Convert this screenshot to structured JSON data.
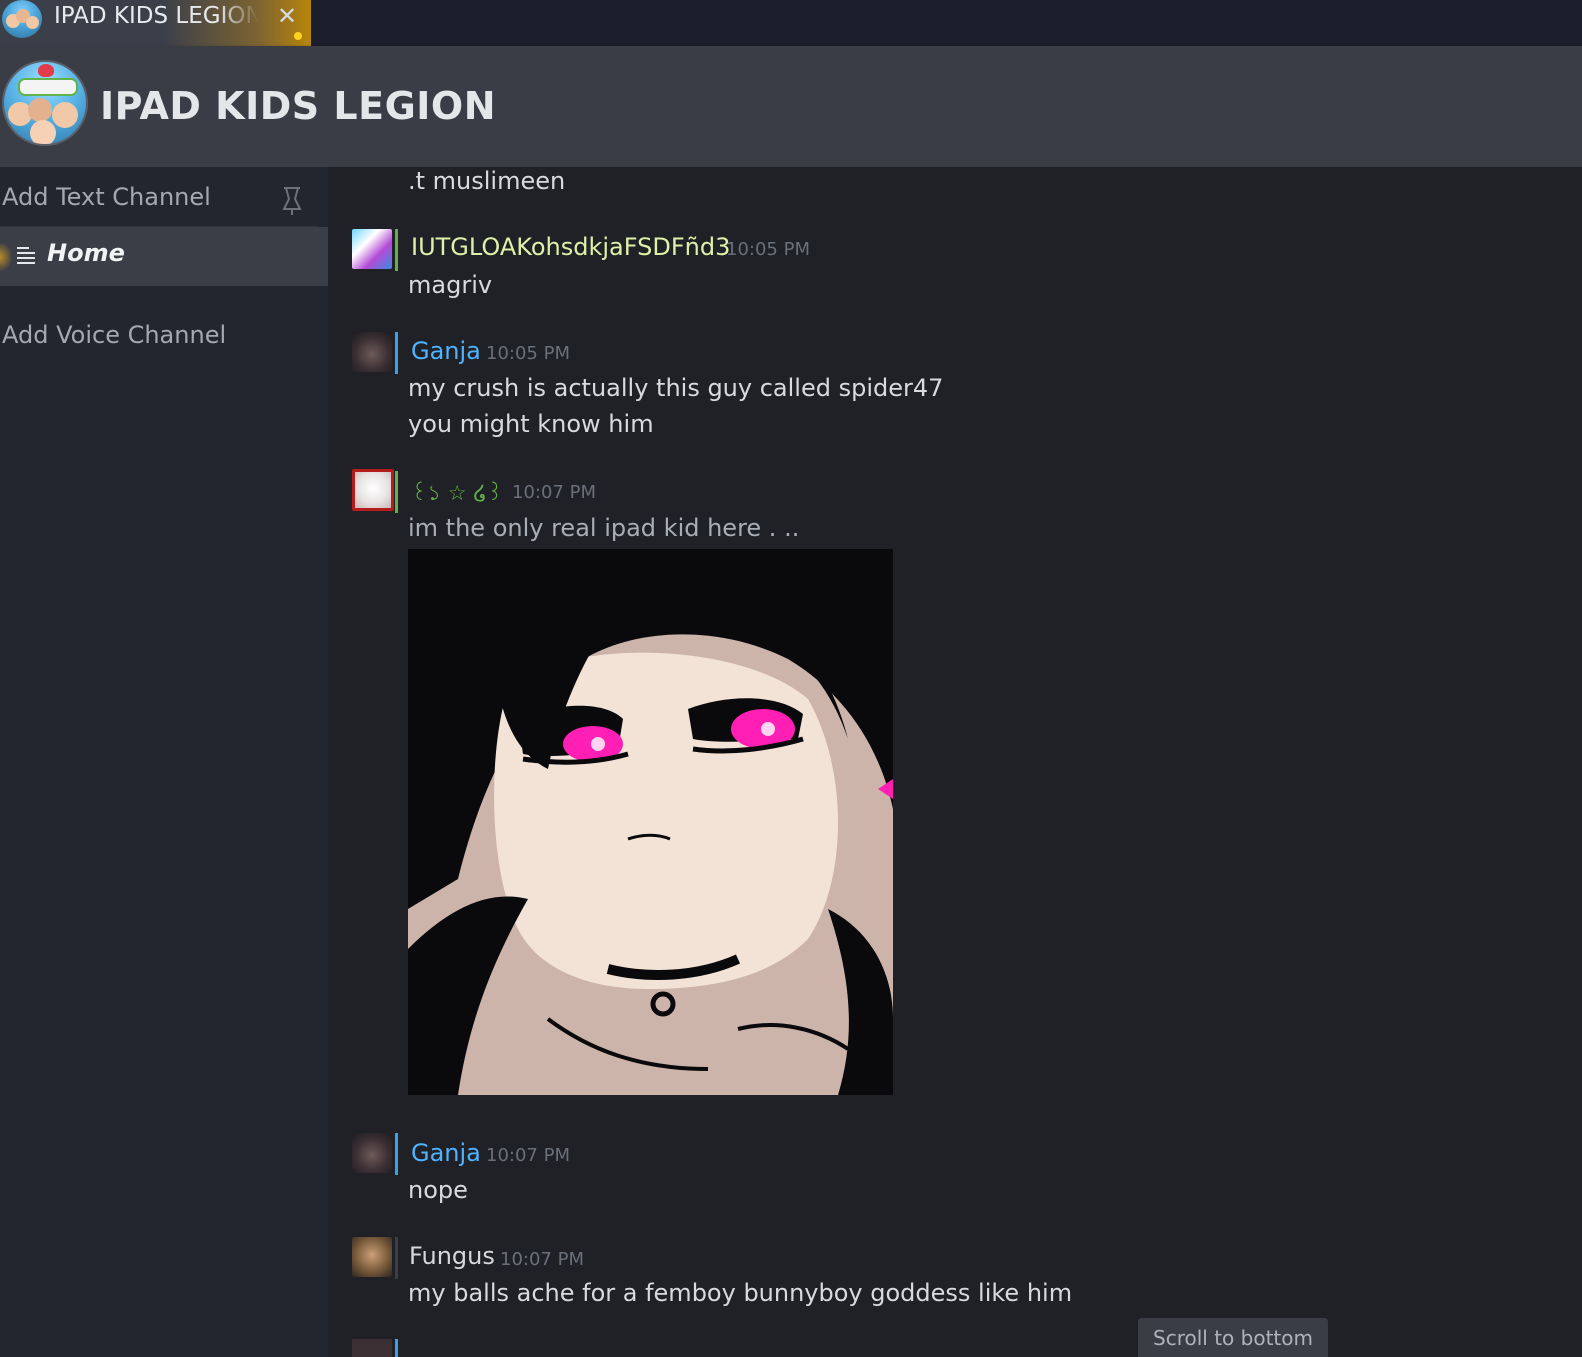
{
  "tab": {
    "title": "IPAD KIDS LEGION",
    "close_glyph": "✕",
    "unread_dot_color": "#ffd21f"
  },
  "server": {
    "name": "IPAD KIDS LEGION",
    "icon": "cocomelon-server-icon"
  },
  "sidebar": {
    "add_text_channel": "Add Text Channel",
    "pin_icon": "pin-icon",
    "home_label": "Home",
    "home_icon": "hamburger-icon",
    "add_voice_channel": "Add Voice Channel"
  },
  "messages": [
    {
      "author": "",
      "time": "",
      "lines": [
        ".t muslimeen"
      ]
    },
    {
      "author": "IUTGLOAKohsdkjaFSDFñd3",
      "author_color": "#dff0a8",
      "time": "10:05 PM",
      "lines": [
        "magriv"
      ]
    },
    {
      "author": "Ganja",
      "author_color": "#4fb3ff",
      "time": "10:05 PM",
      "lines": [
        "my crush is actually this guy called spider47",
        "you might know him"
      ]
    },
    {
      "author": "꒰১ ☆ ໒꒱",
      "author_color": "#66b04a",
      "time": "10:07 PM",
      "lines": [
        "im the only real ipad kid here . .."
      ],
      "has_image": true
    },
    {
      "author": "Ganja",
      "author_color": "#4fb3ff",
      "time": "10:07 PM",
      "lines": [
        "nope"
      ]
    },
    {
      "author": "Fungus",
      "author_color": "#d6d8dc",
      "time": "10:07 PM",
      "lines": [
        "my balls ache for a femboy bunnyboy goddess like him"
      ]
    }
  ],
  "scroll_to_bottom": "Scroll to bottom",
  "colors": {
    "background": "#1f2127",
    "header": "#3a3d46",
    "sidebar": "#23262e",
    "sidebar_selected": "#3b3e47",
    "accent_bar": "#3aa0e8",
    "green_bar": "#66b04a"
  }
}
